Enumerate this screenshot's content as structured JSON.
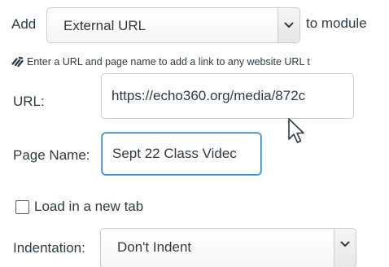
{
  "module_row": {
    "prefix_label": "Add",
    "type_select_value": "External URL",
    "suffix_label": "to module"
  },
  "hint": {
    "icon": "link-icon",
    "text": "Enter a URL and page name to add a link to any website URL t"
  },
  "url_field": {
    "label": "URL:",
    "value": "https://echo360.org/media/872c"
  },
  "page_name_field": {
    "label": "Page Name:",
    "value": "Sept 22 Class Videc"
  },
  "new_tab": {
    "label": "Load in a new tab",
    "checked": false
  },
  "indentation": {
    "label": "Indentation:",
    "value": "Don't Indent"
  },
  "icons": {
    "dropdown": "chevron-down-icon",
    "cursor": "mouse-pointer-icon"
  },
  "colors": {
    "text": "#2d3b45",
    "border": "#c7cdd1",
    "focus": "#2b7abc"
  }
}
